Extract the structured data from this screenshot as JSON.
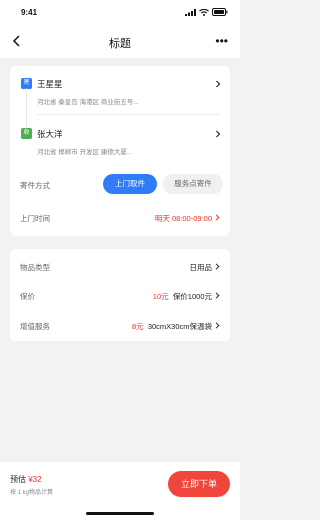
{
  "status_bar": {
    "time": "9:41"
  },
  "nav": {
    "title": "标题",
    "more": "•••"
  },
  "sender": {
    "badge": "寄",
    "name": "王星星",
    "address": "河北省 秦皇岛 海港区 商业街五号..."
  },
  "receiver": {
    "badge": "收",
    "name": "张大洋",
    "address": "河北省 邯郸市 开发区 康德大厦..."
  },
  "pickup_method": {
    "label": "寄件方式",
    "options": [
      "上门取件",
      "服务点寄件"
    ],
    "selected": "上门取件"
  },
  "pickup_time": {
    "label": "上门时间",
    "value": "明天 08:00-09:00"
  },
  "item_type": {
    "label": "物品类型",
    "value": "日用品"
  },
  "insurance": {
    "label": "保价",
    "price": "10元",
    "value": "保价1000元"
  },
  "value_added": {
    "label": "增值服务",
    "price": "8元",
    "value": "30cmX30cm保温袋"
  },
  "bottom": {
    "estimate_label": "预估",
    "estimate_price": "¥32",
    "note": "按 1 kg物品计算",
    "order_button": "立即下单"
  },
  "colors": {
    "primary": "#2f7cf6",
    "danger": "#e5332a",
    "order": "#f0453a"
  }
}
